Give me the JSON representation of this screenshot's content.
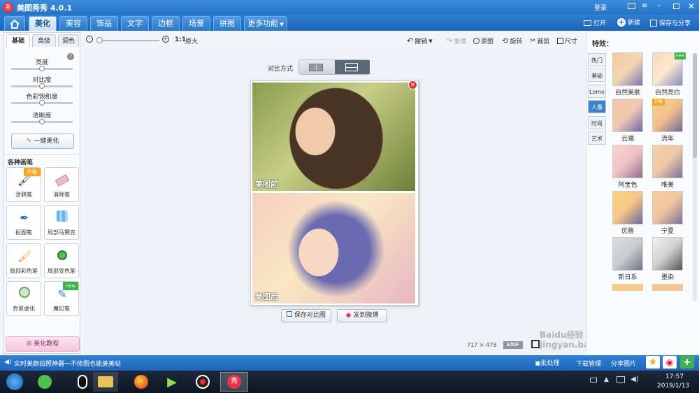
{
  "app": {
    "title": "美图秀秀 4.0.1",
    "login": "登录"
  },
  "menu": {
    "home_icon": "home-icon",
    "tabs": [
      "美化",
      "美容",
      "饰品",
      "文字",
      "边框",
      "场景",
      "拼图",
      "更多功能"
    ],
    "active": "美化",
    "open": "打开",
    "new": "新建",
    "save_share": "保存与分享"
  },
  "left": {
    "tabs": [
      "基础",
      "高级",
      "调色"
    ],
    "sliders": [
      {
        "label": "亮度",
        "value": 0.5
      },
      {
        "label": "对比度",
        "value": 0.5
      },
      {
        "label": "色彩饱和度",
        "value": 0.5
      },
      {
        "label": "清晰度",
        "value": 0.5
      }
    ],
    "one_click": "一键美化",
    "brushes_title": "各种画笔",
    "brushes": [
      {
        "label": "涂鸦笔",
        "badge": "升级"
      },
      {
        "label": "消除笔",
        "badge": ""
      },
      {
        "label": "抠图笔",
        "badge": ""
      },
      {
        "label": "局部马赛克",
        "badge": ""
      },
      {
        "label": "局部彩色笔",
        "badge": ""
      },
      {
        "label": "局部变色笔",
        "badge": ""
      },
      {
        "label": "背景虚化",
        "badge": ""
      },
      {
        "label": "魔幻笔",
        "badge": "new"
      }
    ],
    "tutorial": "美化教程"
  },
  "toolbar": {
    "zoom_ratio": "1:1",
    "original_size": "原大",
    "undo": "撤销",
    "redo": "重做",
    "original": "原图",
    "rotate": "旋转",
    "crop": "裁剪",
    "size": "尺寸"
  },
  "compare": {
    "label": "对比方式",
    "before": "美图前",
    "after": "美图后",
    "save_compare": "保存对比图",
    "send_weibo": "发到微博"
  },
  "image_info": {
    "dimensions": "717 × 478",
    "exif": "EXIF"
  },
  "right": {
    "title": "特效：",
    "tabs": [
      "热门",
      "基础",
      "Lomo",
      "人像",
      "时尚",
      "艺术"
    ],
    "active_tab": "人像",
    "effects": [
      {
        "label": "自然美肤",
        "badge": ""
      },
      {
        "label": "自然亮白",
        "badge": "new"
      },
      {
        "label": "云端",
        "badge": ""
      },
      {
        "label": "流年",
        "badge": "升级"
      },
      {
        "label": "阿宝色",
        "badge": ""
      },
      {
        "label": "唯美",
        "badge": ""
      },
      {
        "label": "优格",
        "badge": ""
      },
      {
        "label": "宁夏",
        "badge": ""
      },
      {
        "label": "新日系",
        "badge": ""
      },
      {
        "label": "墨染",
        "badge": ""
      }
    ]
  },
  "status": {
    "message": "实时美颜拍照神器一不修图也能美美哒",
    "batch": "批处理",
    "download": "下载管理",
    "share": "分享图片"
  },
  "taskbar": {
    "time": "17:57",
    "date": "2019/1/13"
  },
  "watermark": "Baidu经验 jingyan.baidu.com"
}
